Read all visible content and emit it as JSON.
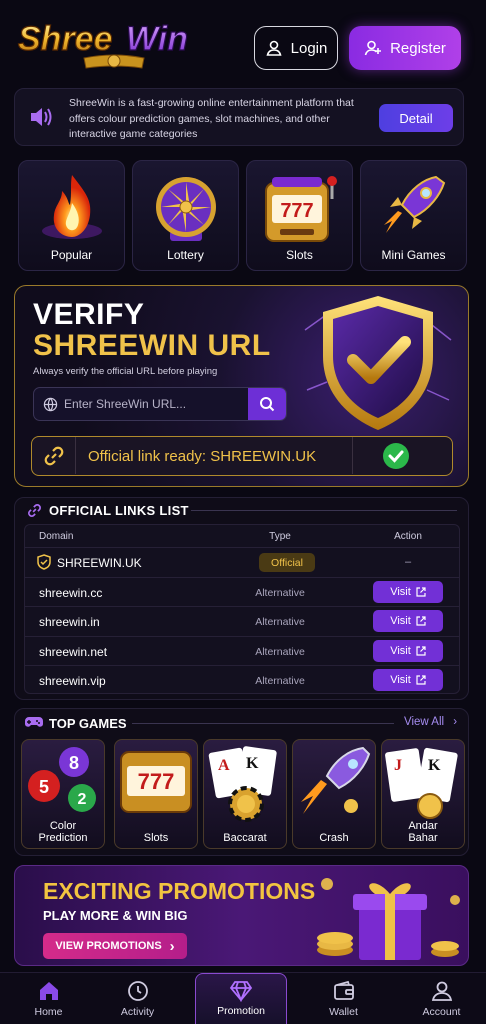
{
  "header": {
    "logo_text": "ShreeWin",
    "login_label": "Login",
    "register_label": "Register"
  },
  "notice": {
    "text": "ShreeWin is a fast-growing online entertainment platform that offers colour prediction games, slot machines, and other interactive game categories",
    "detail_label": "Detail"
  },
  "categories": [
    {
      "label": "Popular",
      "icon": "flame-icon"
    },
    {
      "label": "Lottery",
      "icon": "wheel-icon"
    },
    {
      "label": "Slots",
      "icon": "slot-machine-icon"
    },
    {
      "label": "Mini Games",
      "icon": "rocket-icon"
    }
  ],
  "verify": {
    "title_line1": "VERIFY",
    "title_line2": "SHREEWIN URL",
    "subtitle": "Always verify the official URL before playing",
    "search_placeholder": "Enter ShreeWin URL...",
    "ready_text": "Official link ready: SHREEWIN.UK"
  },
  "links": {
    "title": "OFFICIAL LINKS LIST",
    "columns": [
      "Domain",
      "Type",
      "Action"
    ],
    "rows": [
      {
        "domain": "SHREEWIN.UK",
        "type": "Official",
        "action": "–"
      },
      {
        "domain": "shreewin.cc",
        "type": "Alternative",
        "action": "Visit"
      },
      {
        "domain": "shreewin.in",
        "type": "Alternative",
        "action": "Visit"
      },
      {
        "domain": "shreewin.net",
        "type": "Alternative",
        "action": "Visit"
      },
      {
        "domain": "shreewin.vip",
        "type": "Alternative",
        "action": "Visit"
      }
    ]
  },
  "games": {
    "title": "TOP GAMES",
    "view_all": "View All",
    "items": [
      {
        "label": "Color Prediction",
        "line1": "Color",
        "line2": "Prediction"
      },
      {
        "label": "Slots",
        "line1": "Slots",
        "line2": ""
      },
      {
        "label": "Baccarat",
        "line1": "Baccarat",
        "line2": ""
      },
      {
        "label": "Crash",
        "line1": "Crash",
        "line2": ""
      },
      {
        "label": "Andar Bahar",
        "line1": "Andar",
        "line2": "Bahar"
      }
    ],
    "ball_numbers": [
      "8",
      "5",
      "2"
    ],
    "card_ranks": [
      "A",
      "K",
      "J"
    ],
    "slot_reels": "777"
  },
  "promo": {
    "title": "EXCITING PROMOTIONS",
    "subtitle": "PLAY MORE & WIN BIG",
    "button": "VIEW PROMOTIONS"
  },
  "nav": [
    {
      "label": "Home"
    },
    {
      "label": "Activity"
    },
    {
      "label": "Promotion"
    },
    {
      "label": "Wallet"
    },
    {
      "label": "Account"
    }
  ],
  "colors": {
    "accent_purple": "#8a2be2",
    "gold": "#f0c24a",
    "background": "#0a0813"
  }
}
